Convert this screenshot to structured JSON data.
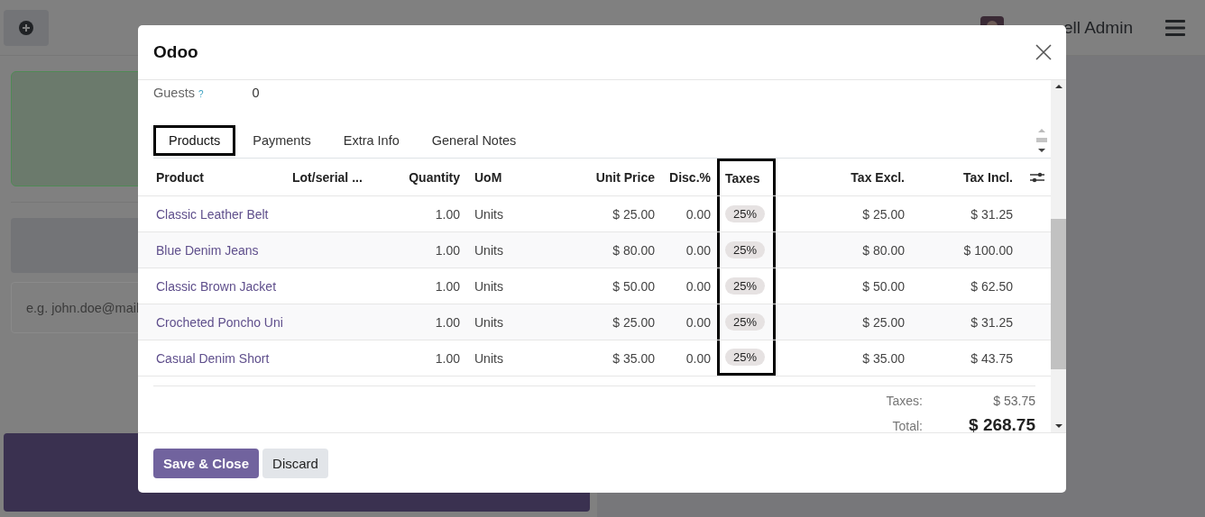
{
  "background": {
    "user_name": "ell Admin",
    "email_placeholder": "e.g. john.doe@mail"
  },
  "dialog": {
    "title": "Odoo",
    "guests_label": "Guests",
    "guests_help": "?",
    "guests_value": "0",
    "tabs": [
      {
        "label": "Products",
        "selected": true,
        "highlighted": true
      },
      {
        "label": "Payments",
        "selected": false,
        "highlighted": false
      },
      {
        "label": "Extra Info",
        "selected": false,
        "highlighted": false
      },
      {
        "label": "General Notes",
        "selected": false,
        "highlighted": false
      }
    ],
    "columns": [
      {
        "label": "Product",
        "highlighted": false
      },
      {
        "label": "Lot/serial ...",
        "highlighted": false
      },
      {
        "label": "Quantity",
        "highlighted": false
      },
      {
        "label": "UoM",
        "highlighted": false
      },
      {
        "label": "Unit Price",
        "highlighted": false
      },
      {
        "label": "Disc.%",
        "highlighted": false
      },
      {
        "label": "Taxes",
        "highlighted": true
      },
      {
        "label": "Tax Excl.",
        "highlighted": false
      },
      {
        "label": "Tax Incl.",
        "highlighted": false
      }
    ],
    "rows": [
      {
        "product": "Classic Leather Belt",
        "quantity": "1.00",
        "uom": "Units",
        "unit_price": "$ 25.00",
        "discount": "0.00",
        "tax": "25%",
        "tax_excl": "$ 25.00",
        "tax_incl": "$ 31.25"
      },
      {
        "product": "Blue Denim Jeans",
        "quantity": "1.00",
        "uom": "Units",
        "unit_price": "$ 80.00",
        "discount": "0.00",
        "tax": "25%",
        "tax_excl": "$ 80.00",
        "tax_incl": "$ 100.00"
      },
      {
        "product": "Classic Brown Jacket",
        "quantity": "1.00",
        "uom": "Units",
        "unit_price": "$ 50.00",
        "discount": "0.00",
        "tax": "25%",
        "tax_excl": "$ 50.00",
        "tax_incl": "$ 62.50"
      },
      {
        "product": "Crocheted Poncho Uni",
        "quantity": "1.00",
        "uom": "Units",
        "unit_price": "$ 25.00",
        "discount": "0.00",
        "tax": "25%",
        "tax_excl": "$ 25.00",
        "tax_incl": "$ 31.25"
      },
      {
        "product": "Casual Denim Short",
        "quantity": "1.00",
        "uom": "Units",
        "unit_price": "$ 35.00",
        "discount": "0.00",
        "tax": "25%",
        "tax_excl": "$ 35.00",
        "tax_incl": "$ 43.75"
      }
    ],
    "totals": [
      {
        "label": "Taxes:",
        "value": "$ 53.75",
        "kind": "sub"
      },
      {
        "label": "Total:",
        "value": "$ 268.75",
        "kind": "grand"
      }
    ],
    "buttons": [
      {
        "label": "Save & Close",
        "kind": "primary"
      },
      {
        "label": "Discard",
        "kind": "secondary"
      }
    ]
  }
}
